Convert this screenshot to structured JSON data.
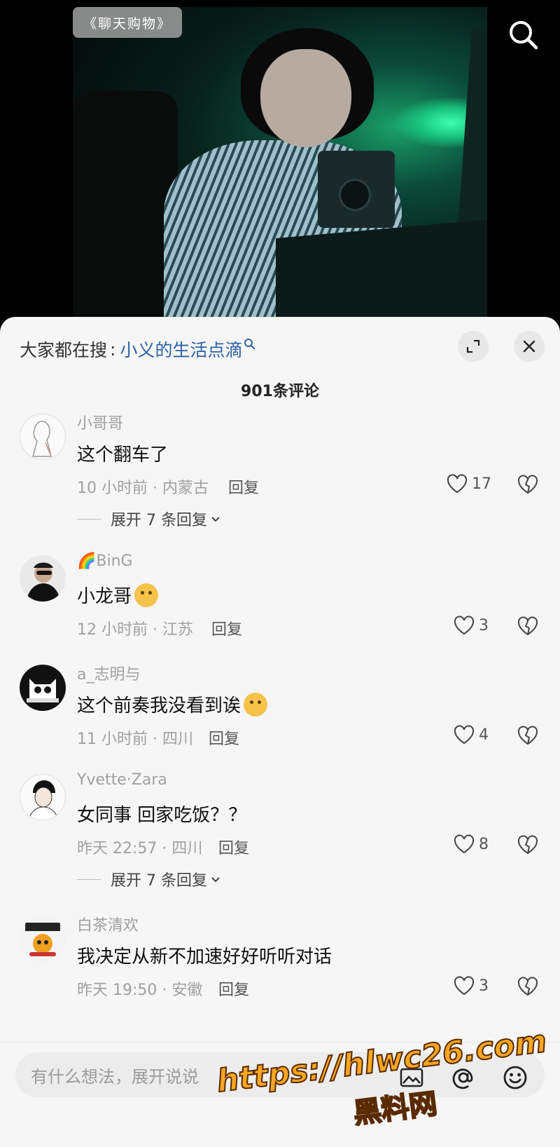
{
  "video": {
    "title_badge": "《聊天购物》"
  },
  "sheet": {
    "hot_search_label": "大家都在搜",
    "hot_search_sep": ":",
    "hot_search_keyword": "小义的生活点滴",
    "comment_count": "901条评论"
  },
  "comments": [
    {
      "username": "小哥哥",
      "text": "这个翻车了",
      "meta": "10 小时前 · 内蒙古",
      "reply": "回复",
      "likes": "17",
      "expand": "展开 7 条回复"
    },
    {
      "username": "🌈BinG",
      "text": "小龙哥",
      "meta": "12 小时前 · 江苏",
      "reply": "回复",
      "likes": "3"
    },
    {
      "username": "a_志明与",
      "text": "这个前奏我没看到诶",
      "meta": "11 小时前 · 四川",
      "reply": "回复",
      "likes": "4"
    },
    {
      "username": "Yvette·Zara",
      "text": "女同事  回家吃饭？？",
      "meta": "昨天 22:57 · 四川",
      "reply": "回复",
      "likes": "8",
      "expand": "展开 7 条回复"
    },
    {
      "username": "白茶清欢",
      "text": "我决定从新不加速好好听听对话",
      "meta": "昨天 19:50 · 安徽",
      "reply": "回复",
      "likes": "3"
    }
  ],
  "input": {
    "placeholder": "有什么想法，展开说说"
  },
  "watermark": {
    "url": "https://hlwc26.com",
    "site": "黑料网"
  },
  "icons": {
    "search": "search-icon",
    "expand": "expand-icon",
    "close": "close-icon",
    "like": "heart-icon",
    "dislike": "broken-heart-icon",
    "image": "image-icon",
    "at": "at-icon",
    "emoji": "emoji-icon"
  }
}
